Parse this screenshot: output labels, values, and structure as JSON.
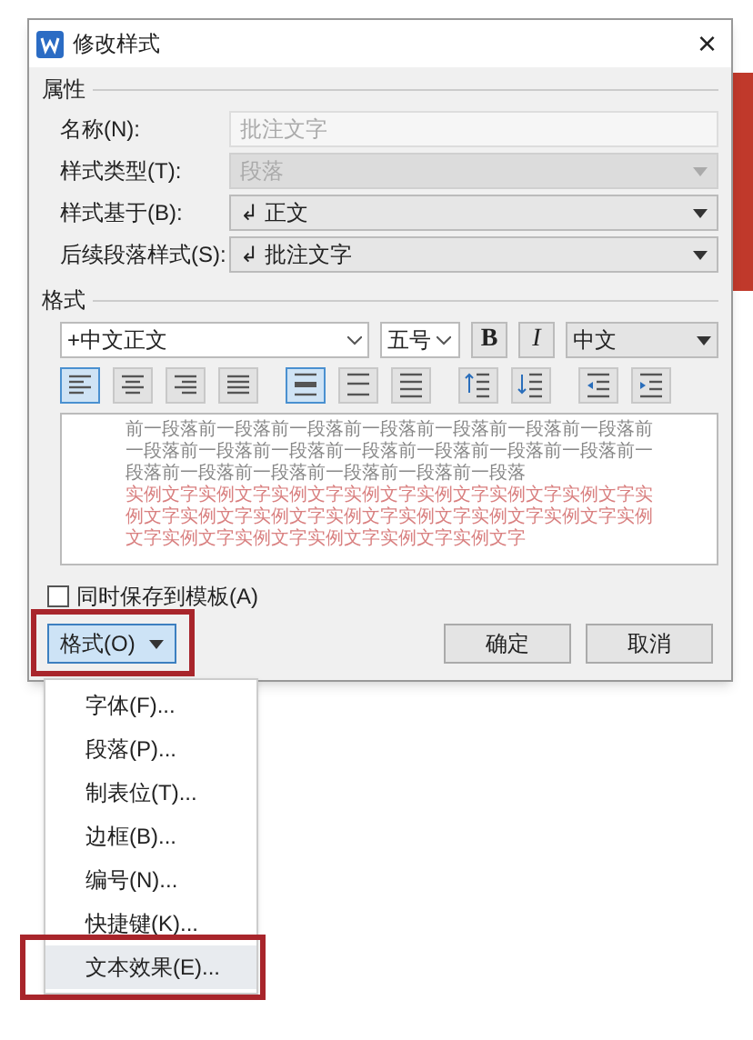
{
  "window": {
    "title": "修改样式",
    "close": "×"
  },
  "properties": {
    "heading": "属性",
    "fields": [
      {
        "label": "名称(N):",
        "value": "批注文字",
        "kind": "text",
        "disabled": true
      },
      {
        "label": "样式类型(T):",
        "value": "段落",
        "kind": "select",
        "disabled": true
      },
      {
        "label": "样式基于(B):",
        "value": "↲ 正文",
        "kind": "select",
        "disabled": false
      },
      {
        "label": "后续段落样式(S):",
        "value": "↲ 批注文字",
        "kind": "select",
        "disabled": false
      }
    ]
  },
  "format": {
    "heading": "格式",
    "font": "+中文正文",
    "size": "五号",
    "bold": "B",
    "italic": "I",
    "script": "中文",
    "tools": [
      {
        "kind": "align-left",
        "selected": true
      },
      {
        "kind": "align-center",
        "selected": false
      },
      {
        "kind": "align-right",
        "selected": false
      },
      {
        "kind": "justify",
        "selected": false
      },
      {
        "kind": "spacing-single",
        "selected": true
      },
      {
        "kind": "spacing-half",
        "selected": false
      },
      {
        "kind": "spacing-double",
        "selected": false
      },
      {
        "kind": "space-up",
        "selected": false
      },
      {
        "kind": "space-down",
        "selected": false
      },
      {
        "kind": "indent-less",
        "selected": false
      },
      {
        "kind": "indent-more",
        "selected": false
      }
    ],
    "preview": [
      {
        "kind": "previous",
        "text": "前一段落前一段落前一段落前一段落前一段落前一段落前一段落前一段落前一段落前一段落前一段落前一段落前一段落前一段落前一段落前一段落前一段落前一段落前一段落前一段落"
      },
      {
        "kind": "sample",
        "text": "实例文字实例文字实例文字实例文字实例文字实例文字实例文字实例文字实例文字实例文字实例文字实例文字实例文字实例文字实例文字实例文字实例文字实例文字实例文字实例文字"
      }
    ]
  },
  "save_to_template": {
    "label": "同时保存到模板(A)",
    "checked": false
  },
  "buttons": {
    "format": {
      "label": "格式(O)",
      "highlighted": true
    },
    "ok": "确定",
    "cancel": "取消"
  },
  "menu": [
    {
      "label": "字体(F)...",
      "highlighted": false,
      "selected": false
    },
    {
      "label": "段落(P)...",
      "highlighted": false,
      "selected": false
    },
    {
      "label": "制表位(T)...",
      "highlighted": false,
      "selected": false
    },
    {
      "label": "边框(B)...",
      "highlighted": false,
      "selected": false
    },
    {
      "label": "编号(N)...",
      "highlighted": false,
      "selected": false
    },
    {
      "label": "快捷键(K)...",
      "highlighted": false,
      "selected": false
    },
    {
      "label": "文本效果(E)...",
      "highlighted": true,
      "selected": true
    }
  ]
}
